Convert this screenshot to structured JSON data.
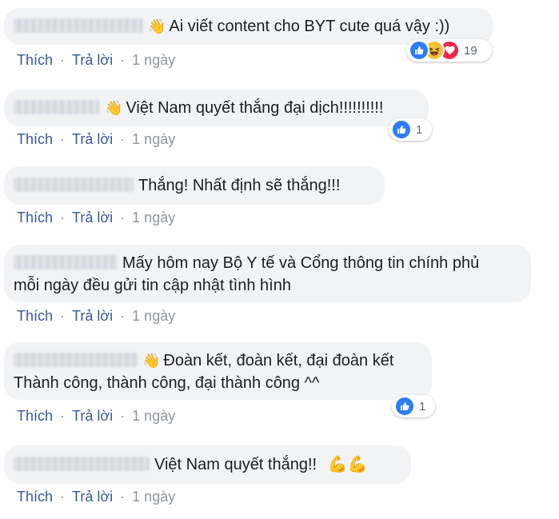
{
  "actions": {
    "like": "Thích",
    "reply": "Trả lời",
    "time": "1 ngày",
    "separator": "·"
  },
  "comments": [
    {
      "text": "Ai viết content cho BYT cute quá vậy :))",
      "reactions": [
        "like-icon",
        "haha-icon",
        "love-icon"
      ],
      "reaction_count": "19"
    },
    {
      "text": "Việt Nam quyết thắng đại dịch!!!!!!!!!!",
      "reactions": [
        "like-icon"
      ],
      "reaction_count": "1"
    },
    {
      "text": "Thắng! Nhất định sẽ thắng!!!",
      "reactions": [],
      "reaction_count": ""
    },
    {
      "text_line1": "Mấy hôm nay Bộ Y tế và Cổng thông tin chính phủ",
      "text_line2": "mỗi ngày đều gửi tin cập nhật tình hình",
      "reactions": [],
      "reaction_count": ""
    },
    {
      "text_line1": "Đoàn kết, đoàn kết, đại đoàn kết",
      "text_line2": "Thành công, thành công, đại thành công ^^",
      "reactions": [
        "like-icon"
      ],
      "reaction_count": "1"
    },
    {
      "text": "Việt Nam quyết thắng!!",
      "emoji": "💪💪",
      "reactions": [],
      "reaction_count": ""
    }
  ],
  "colors": {
    "bubble": "#f2f3f5",
    "link": "#385898",
    "meta": "#90949c",
    "like": "#2e7cf6",
    "love": "#f0284a",
    "haha": "#f7c33d"
  }
}
